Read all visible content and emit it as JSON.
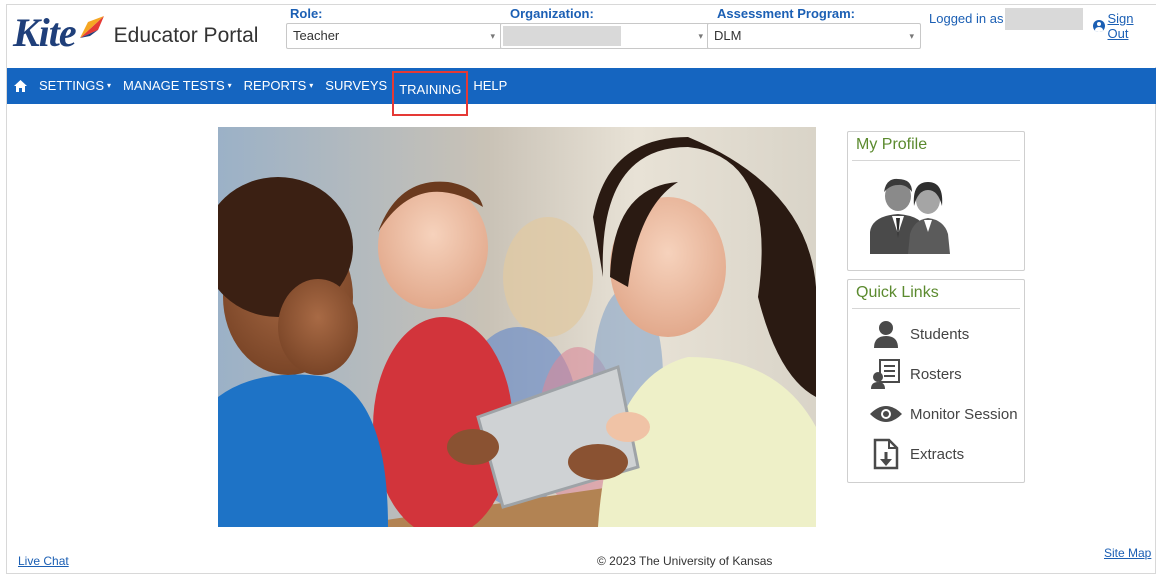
{
  "header": {
    "logo_word": "Kite",
    "portal_name": "Educator Portal",
    "role": {
      "label": "Role:",
      "value": "Teacher"
    },
    "organization": {
      "label": "Organization:",
      "value": ""
    },
    "assessment_program": {
      "label": "Assessment Program:",
      "value": "DLM"
    },
    "logged_in_as": "Logged in as",
    "sign_out": "Sign Out"
  },
  "nav": {
    "items": [
      {
        "label": "SETTINGS",
        "dropdown": true
      },
      {
        "label": "MANAGE TESTS",
        "dropdown": true
      },
      {
        "label": "REPORTS",
        "dropdown": true
      },
      {
        "label": "SURVEYS",
        "dropdown": false
      },
      {
        "label": "TRAINING",
        "dropdown": false,
        "highlighted": true
      },
      {
        "label": "HELP",
        "dropdown": false
      }
    ],
    "dropdown_glyph": "▾",
    "background": "#1565c0",
    "highlight_color": "#e53935"
  },
  "profile_panel": {
    "title": "My Profile"
  },
  "quick_links": {
    "title": "Quick Links",
    "items": [
      {
        "label": "Students",
        "icon": "student-icon"
      },
      {
        "label": "Rosters",
        "icon": "roster-icon"
      },
      {
        "label": "Monitor Session",
        "icon": "eye-icon"
      },
      {
        "label": "Extracts",
        "icon": "extract-icon"
      }
    ]
  },
  "footer": {
    "live_chat": "Live Chat",
    "copyright": "© 2023 The University of Kansas",
    "site_map": "Site Map"
  },
  "colors": {
    "accent_blue": "#1b5fb4",
    "panel_title_green": "#5b8a2e"
  }
}
